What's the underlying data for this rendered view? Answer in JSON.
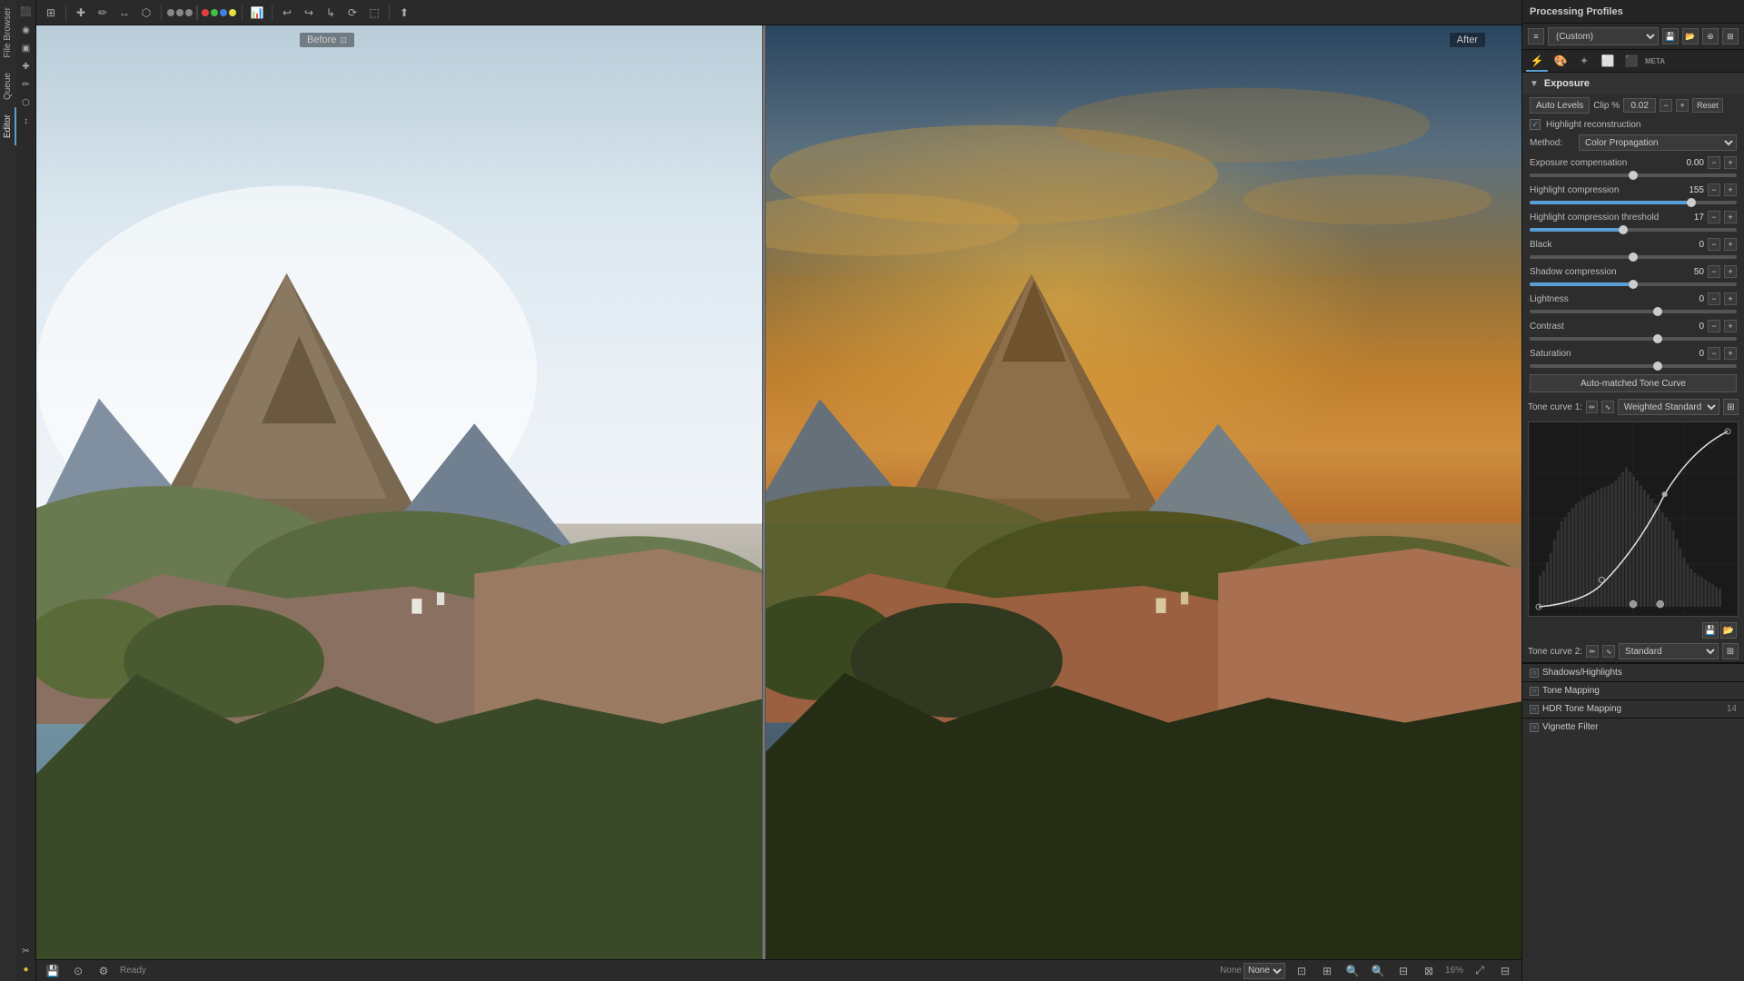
{
  "app": {
    "title": "Processing Profiles"
  },
  "toolbar": {
    "before_label": "Before",
    "after_label": "After"
  },
  "status": {
    "text": "Ready",
    "zoom": "16%",
    "mode": "None"
  },
  "profile": {
    "current": "(Custom)",
    "placeholder": "(Custom)"
  },
  "exposure": {
    "section_title": "Exposure",
    "auto_levels_label": "Auto Levels",
    "clip_percent_label": "Clip %",
    "clip_value": "0.02",
    "reset_label": "Reset",
    "highlight_reconstruction_label": "Highlight reconstruction",
    "method_label": "Method:",
    "method_value": "Color Propagation",
    "exposure_compensation_label": "Exposure compensation",
    "exposure_compensation_value": "0.00",
    "highlight_compression_label": "Highlight compression",
    "highlight_compression_value": "155",
    "highlight_compression_threshold_label": "Highlight compression threshold",
    "highlight_compression_threshold_value": "17",
    "black_label": "Black",
    "black_value": "0",
    "shadow_compression_label": "Shadow compression",
    "shadow_compression_value": "50",
    "lightness_label": "Lightness",
    "lightness_value": "0",
    "contrast_label": "Contrast",
    "contrast_value": "0",
    "saturation_label": "Saturation",
    "saturation_value": "0"
  },
  "tone_curve": {
    "auto_matched_label": "Auto-matched Tone Curve",
    "curve1_label": "Tone curve 1:",
    "curve1_value": "Weighted Standard",
    "curve2_label": "Tone curve 2:",
    "curve2_value": "Standard"
  },
  "sections": {
    "shadows_highlights": "Shadows/Highlights",
    "tone_mapping": "Tone Mapping",
    "hdr_tone_mapping": "HDR Tone Mapping",
    "vignette_filter": "Vignette Filter"
  },
  "hdr_num": "14",
  "sidebar_tabs": [
    {
      "label": "File Browser",
      "id": "file-browser"
    },
    {
      "label": "Queue",
      "id": "queue"
    },
    {
      "label": "Editor",
      "id": "editor"
    }
  ],
  "tool_tabs": [
    {
      "icon": "⚡",
      "id": "exposure-tab"
    },
    {
      "icon": "🎨",
      "id": "color-tab"
    },
    {
      "icon": "🔧",
      "id": "detail-tab"
    },
    {
      "icon": "📐",
      "id": "transform-tab"
    },
    {
      "icon": "⬛",
      "id": "raw-tab"
    },
    {
      "icon": "◈",
      "id": "meta-tab"
    }
  ],
  "sliders": {
    "exposure_compensation": {
      "position": 50
    },
    "highlight_compression": {
      "position": 78
    },
    "highlight_threshold": {
      "position": 45
    },
    "black": {
      "position": 50
    },
    "shadow_compression": {
      "position": 50
    },
    "lightness": {
      "position": 50
    },
    "contrast": {
      "position": 50
    },
    "saturation": {
      "position": 50
    }
  }
}
